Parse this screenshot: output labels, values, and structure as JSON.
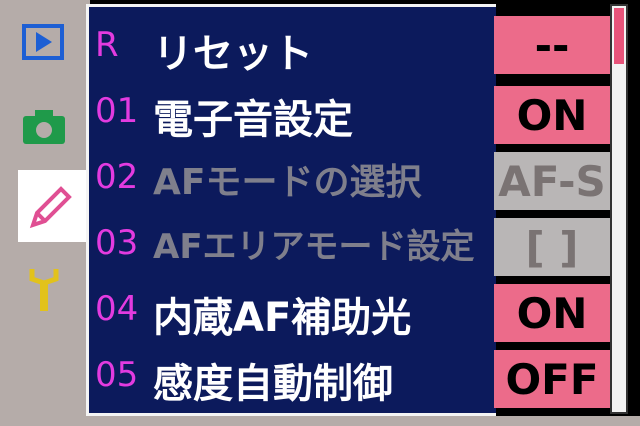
{
  "tabs": [
    {
      "icon": "playback-icon",
      "color": "#1d5fd4"
    },
    {
      "icon": "camera-icon",
      "color": "#1f9a4a"
    },
    {
      "icon": "pencil-icon",
      "color": "#e04f93"
    },
    {
      "icon": "wrench-icon",
      "color": "#e2c21b"
    }
  ],
  "menu": {
    "rows": [
      {
        "num": "R",
        "label": "リセット",
        "value": "--",
        "disabled": false
      },
      {
        "num": "01",
        "label": "電子音設定",
        "value": "ON",
        "disabled": false
      },
      {
        "num": "02",
        "label": "AFモードの選択",
        "value": "AF-S",
        "disabled": true
      },
      {
        "num": "03",
        "label": "AFエリアモード設定",
        "value": "[ ]",
        "disabled": true
      },
      {
        "num": "04",
        "label": "内蔵AF補助光",
        "value": "ON",
        "disabled": false
      },
      {
        "num": "05",
        "label": "感度自動制御",
        "value": "OFF",
        "disabled": false
      }
    ]
  },
  "scrollbar": {
    "position": "top"
  }
}
